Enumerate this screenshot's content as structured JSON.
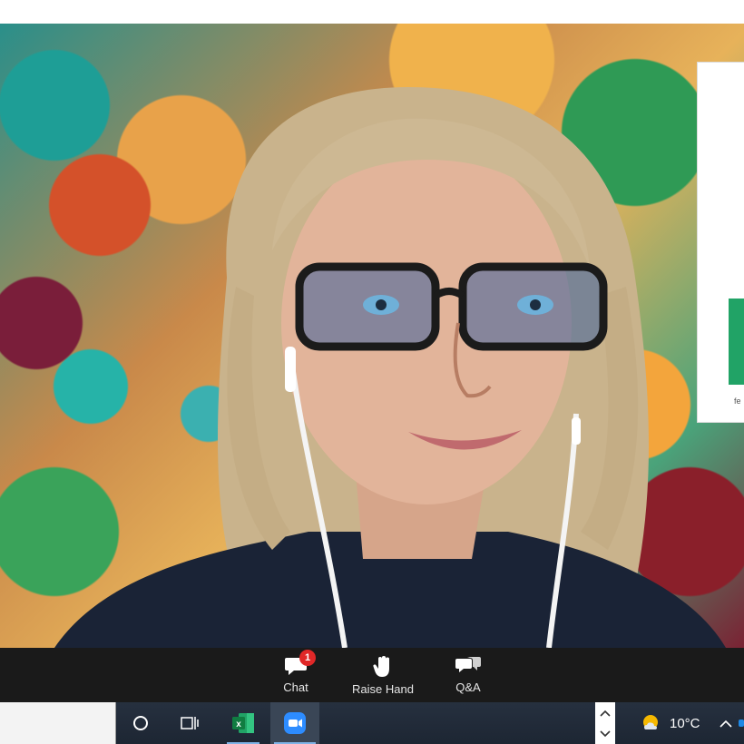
{
  "meeting": {
    "controls": {
      "chat": {
        "label": "Chat",
        "icon": "chat-icon",
        "badge": "1"
      },
      "raise_hand": {
        "label": "Raise Hand",
        "icon": "hand-icon"
      },
      "qa": {
        "label": "Q&A",
        "icon": "qa-icon"
      }
    },
    "shared_slide": {
      "caption": "fe"
    }
  },
  "taskbar": {
    "apps": [
      {
        "name": "Cortana",
        "icon": "cortana-icon"
      },
      {
        "name": "Task View",
        "icon": "task-view-icon"
      },
      {
        "name": "Excel",
        "icon": "excel-icon",
        "letter": "x"
      },
      {
        "name": "Zoom",
        "icon": "zoom-icon",
        "active": true
      }
    ],
    "weather": {
      "temperature": "10°C",
      "icon": "partly-sunny-icon"
    }
  },
  "colors": {
    "control_bar": "#1a1a1a",
    "taskbar": "#222c39",
    "badge": "#e02828",
    "excel_green": "#21a366",
    "zoom_blue": "#2d8cff"
  }
}
